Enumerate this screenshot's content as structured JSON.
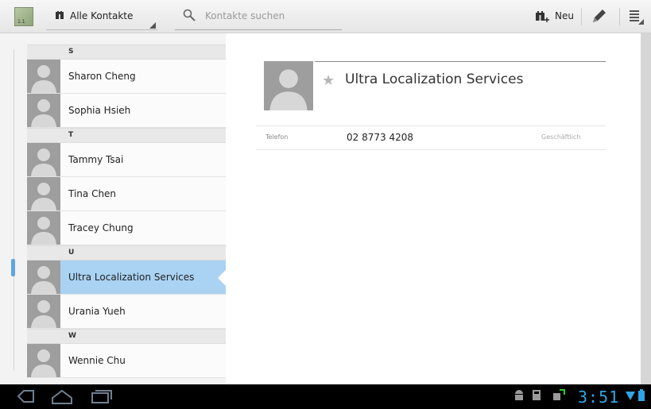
{
  "actionbar": {
    "filter_label": "Alle Kontakte",
    "search_placeholder": "Kontakte suchen",
    "new_label": "Neu"
  },
  "contact_list": {
    "items": [
      {
        "type": "header",
        "label": "S"
      },
      {
        "type": "contact",
        "name": "Sharon Cheng"
      },
      {
        "type": "contact",
        "name": "Sophia Hsieh"
      },
      {
        "type": "header",
        "label": "T"
      },
      {
        "type": "contact",
        "name": "Tammy Tsai"
      },
      {
        "type": "contact",
        "name": "Tina Chen"
      },
      {
        "type": "contact",
        "name": "Tracey Chung"
      },
      {
        "type": "header",
        "label": "U"
      },
      {
        "type": "contact",
        "name": "Ultra Localization Services",
        "selected": true
      },
      {
        "type": "contact",
        "name": "Urania Yueh"
      },
      {
        "type": "header",
        "label": "W"
      },
      {
        "type": "contact",
        "name": "Wennie Chu"
      }
    ]
  },
  "detail": {
    "name": "Ultra Localization Services",
    "phone_kind": "Telefon",
    "phone_number": "02 8773 4208",
    "phone_type": "Geschäftlich"
  },
  "status_bar": {
    "time": "3:51"
  },
  "colors": {
    "selection": "#a9d2f3",
    "clock": "#2ea6e6"
  }
}
